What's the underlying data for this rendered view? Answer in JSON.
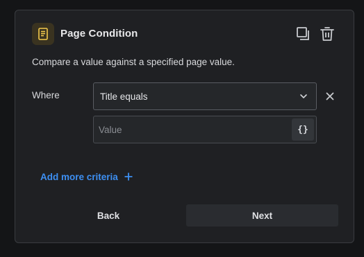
{
  "panel": {
    "title": "Page Condition",
    "icon": "page-document-icon",
    "description": "Compare a value against a specified page value."
  },
  "header_actions": [
    "duplicate-icon",
    "trash-icon"
  ],
  "criteria": {
    "label": "Where",
    "selected_condition": "Title equals",
    "value": "",
    "value_placeholder": "Value",
    "variable_button": "{}"
  },
  "add_criteria": {
    "label": "Add more criteria",
    "icon": "plus-icon"
  },
  "footer": {
    "back_label": "Back",
    "next_label": "Next"
  },
  "colors": {
    "accent_blue": "#3d8ff2",
    "icon_yellow": "#f2c94c",
    "panel_bg": "#1f2023"
  }
}
